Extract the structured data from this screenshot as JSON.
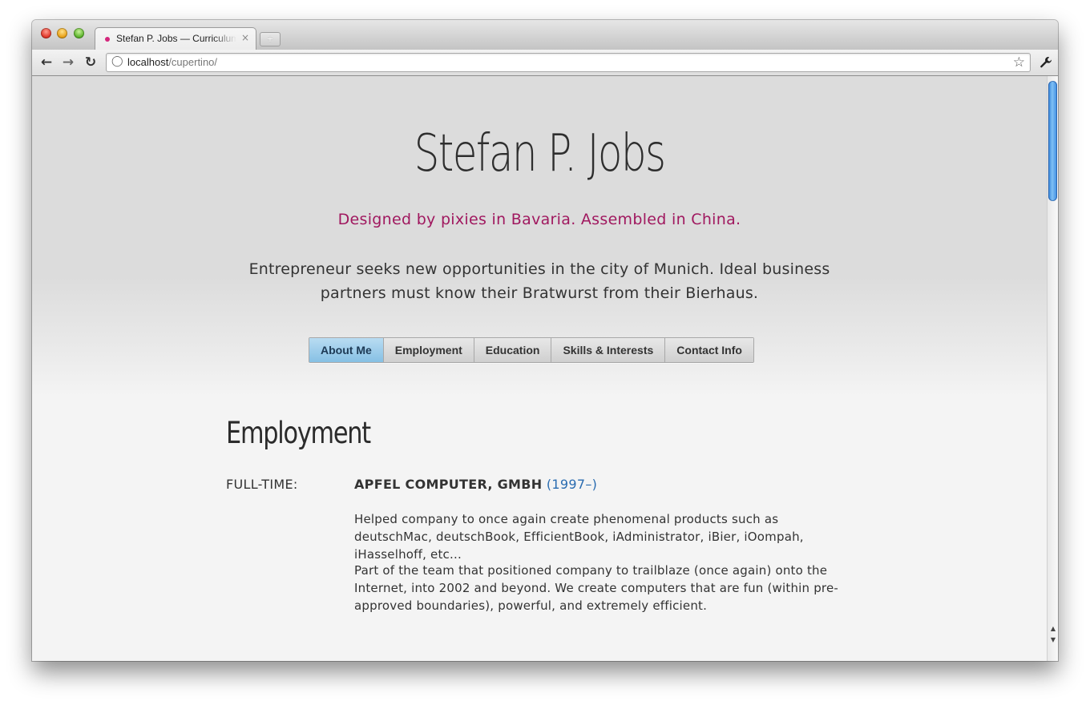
{
  "browser": {
    "tab_title": "Stefan P. Jobs — Curriculum",
    "tab_close": "×",
    "new_tab": "+",
    "url_host": "localhost",
    "url_path": "/cupertino/"
  },
  "page": {
    "title": "Stefan P. Jobs",
    "tagline": "Designed by pixies in Bavaria. Assembled in China.",
    "intro": "Entrepreneur seeks new opportunities in the city of Munich. Ideal business partners must know their Bratwurst from their Bierhaus.",
    "nav": [
      {
        "label": "About Me",
        "active": true
      },
      {
        "label": "Employment",
        "active": false
      },
      {
        "label": "Education",
        "active": false
      },
      {
        "label": "Skills & Interests",
        "active": false
      },
      {
        "label": "Contact Info",
        "active": false
      }
    ],
    "section_title": "Employment",
    "job": {
      "type": "FULL-TIME:",
      "company": "APFEL COMPUTER, GMBH",
      "years": "(1997–)",
      "paragraphs": [
        "Helped company to once again create phenomenal products such as deutschMac, deutschBook, EfficientBook, iAdministrator, iBier, iOompah, iHasselhoff, etc...",
        "Part of the team that positioned company to trailblaze (once again) onto the Internet, into 2002 and beyond. We create computers that are fun (within pre-approved boundaries), powerful, and extremely efficient."
      ]
    }
  },
  "colors": {
    "accent_tagline": "#a0185f",
    "link_years": "#2a6cb0",
    "nav_active": "#86c0e4",
    "favicon": "#d4267c"
  },
  "icons": [
    "close-icon",
    "back-icon",
    "forward-icon",
    "reload-icon",
    "globe-icon",
    "star-icon",
    "wrench-icon"
  ]
}
